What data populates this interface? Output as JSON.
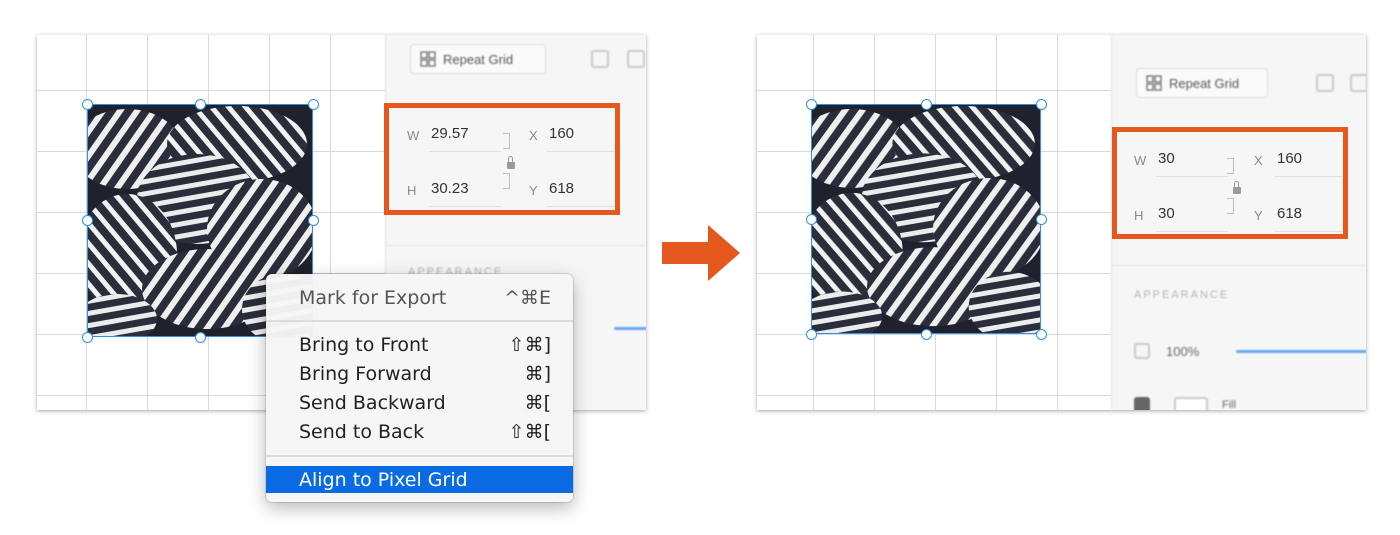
{
  "before": {
    "panel": {
      "repeat_grid_label": "Repeat Grid",
      "section_label": "APPEARANCE"
    },
    "fields": {
      "w_label": "W",
      "w_value": "29.57",
      "h_label": "H",
      "h_value": "30.23",
      "x_label": "X",
      "x_value": "160",
      "y_label": "Y",
      "y_value": "618"
    }
  },
  "after": {
    "panel": {
      "repeat_grid_label": "Repeat Grid",
      "section_label": "APPEARANCE",
      "opacity_value": "100%",
      "fill_label": "Fill"
    },
    "fields": {
      "w_label": "W",
      "w_value": "30",
      "h_label": "H",
      "h_value": "30",
      "x_label": "X",
      "x_value": "160",
      "y_label": "Y",
      "y_value": "618"
    }
  },
  "context_menu": {
    "items": [
      {
        "label": "Mark for Export",
        "shortcut": "^⌘E"
      },
      {
        "label": "Bring to Front",
        "shortcut": "⇧⌘]"
      },
      {
        "label": "Bring Forward",
        "shortcut": "⌘]"
      },
      {
        "label": "Send Backward",
        "shortcut": "⌘["
      },
      {
        "label": "Send to Back",
        "shortcut": "⇧⌘["
      },
      {
        "label": "Align to Pixel Grid",
        "shortcut": ""
      }
    ],
    "highlighted_item": "Align to Pixel Grid"
  },
  "colors": {
    "highlight_box": "#e4571d",
    "arrow": "#e4571d",
    "selection": "#2f8fe9",
    "menu_selected": "#0a6be4"
  },
  "icons": [
    "repeat-grid-icon",
    "lock-icon",
    "arrow-right-icon"
  ]
}
